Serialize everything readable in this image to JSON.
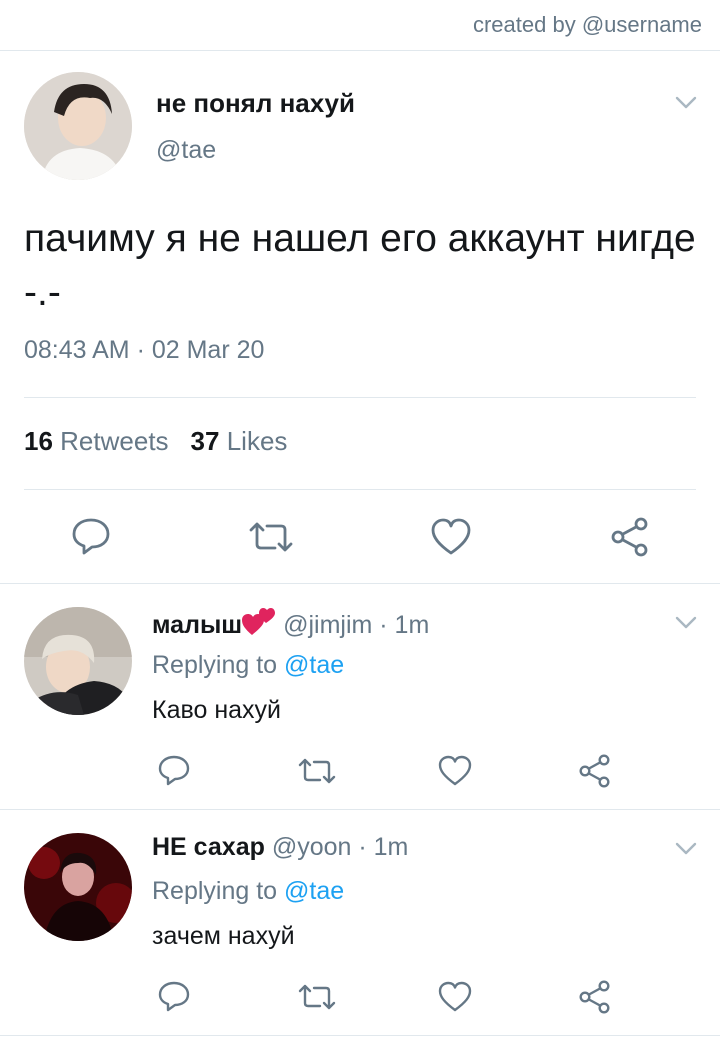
{
  "credit": "created by @username",
  "main_tweet": {
    "display_name": "не понял нахуй",
    "handle": "@tae",
    "text": "пачиму я не нашел его аккаунт нигде -.-",
    "timestamp": "08:43 AM · 02 Mar 20",
    "retweets_count": "16",
    "retweets_label": "Retweets",
    "likes_count": "37",
    "likes_label": "Likes"
  },
  "replies": [
    {
      "display_name": "малыш",
      "name_emoji": "two-hearts-emoji",
      "meta": "@jimjim · 1m",
      "replying_prefix": "Replying to",
      "replying_to": "@tae",
      "text": "Каво нахуй"
    },
    {
      "display_name": "НЕ сахар",
      "meta": "@yoon · 1m",
      "replying_prefix": "Replying to",
      "replying_to": "@tae",
      "text": "зачем нахуй"
    }
  ],
  "icons": [
    "chevron-down-icon",
    "reply-icon",
    "retweet-icon",
    "like-icon",
    "share-icon"
  ],
  "colors": {
    "text": "#14171a",
    "secondary": "#657786",
    "link": "#1da1f2",
    "divider": "#e1e8ed",
    "icon": "#657786",
    "emoji": "#e0245e"
  }
}
